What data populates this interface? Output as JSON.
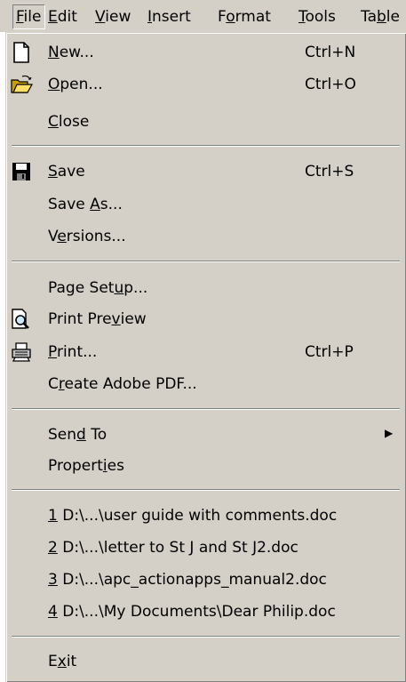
{
  "menubar": {
    "items": [
      {
        "pre": "",
        "key": "F",
        "post": "ile"
      },
      {
        "pre": "",
        "key": "E",
        "post": "dit"
      },
      {
        "pre": "",
        "key": "V",
        "post": "iew"
      },
      {
        "pre": "",
        "key": "I",
        "post": "nsert"
      },
      {
        "pre": "F",
        "key": "o",
        "post": "rmat"
      },
      {
        "pre": "",
        "key": "T",
        "post": "ools"
      },
      {
        "pre": "Ta",
        "key": "b",
        "post": "le"
      }
    ]
  },
  "file_menu": {
    "new": {
      "pre": "",
      "key": "N",
      "post": "ew...",
      "shortcut": "Ctrl+N"
    },
    "open": {
      "pre": "",
      "key": "O",
      "post": "pen...",
      "shortcut": "Ctrl+O"
    },
    "close": {
      "pre": "",
      "key": "C",
      "post": "lose"
    },
    "save": {
      "pre": "",
      "key": "S",
      "post": "ave",
      "shortcut": "Ctrl+S"
    },
    "save_as": {
      "pre": "Save ",
      "key": "A",
      "post": "s..."
    },
    "versions": {
      "pre": "V",
      "key": "e",
      "post": "rsions..."
    },
    "page_setup": {
      "pre": "Page Set",
      "key": "u",
      "post": "p..."
    },
    "print_preview": {
      "pre": "Print Pre",
      "key": "v",
      "post": "iew"
    },
    "print": {
      "pre": "",
      "key": "P",
      "post": "rint...",
      "shortcut": "Ctrl+P"
    },
    "create_pdf": {
      "pre": "C",
      "key": "r",
      "post": "eate Adobe PDF..."
    },
    "send_to": {
      "pre": "Sen",
      "key": "d",
      "post": " To",
      "arrow": "▶"
    },
    "properties": {
      "pre": "Propert",
      "key": "i",
      "post": "es"
    },
    "recent": [
      {
        "key": "1",
        "post": " D:\\...\\user guide with comments.doc"
      },
      {
        "key": "2",
        "post": " D:\\...\\letter to St J and St J2.doc"
      },
      {
        "key": "3",
        "post": " D:\\...\\apc_actionapps_manual2.doc"
      },
      {
        "key": "4",
        "post": " D:\\...\\My Documents\\Dear Philip.doc"
      }
    ],
    "exit": {
      "pre": "E",
      "key": "x",
      "post": "it"
    }
  },
  "icons": {
    "new": "new-document-icon",
    "open": "open-folder-icon",
    "save": "floppy-disk-icon",
    "print_preview": "print-preview-icon",
    "print": "printer-icon"
  }
}
